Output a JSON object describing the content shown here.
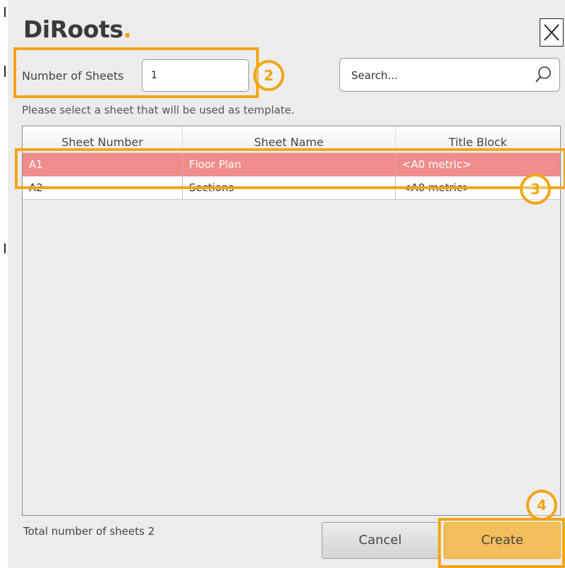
{
  "app": {
    "logo_text": "DiRoots",
    "logo_dot": "."
  },
  "form": {
    "number_label": "Number of Sheets",
    "number_value": "1",
    "search_placeholder": "Search...",
    "hint": "Please select a sheet that will be used as template."
  },
  "table": {
    "columns": [
      "Sheet Number",
      "Sheet Name",
      "Title Block"
    ],
    "rows": [
      {
        "number": "A1",
        "name": "Floor Plan",
        "title_block": "<A0 metric>",
        "selected": true
      },
      {
        "number": "A2",
        "name": "Sections",
        "title_block": "<A0 metric>",
        "selected": false
      }
    ]
  },
  "footer": {
    "total": "Total number of sheets 2",
    "cancel_label": "Cancel",
    "create_label": "Create"
  },
  "annotations": {
    "badges": [
      "2",
      "3",
      "4"
    ],
    "accent_color": "#f2a516"
  },
  "colors": {
    "selected_row": "#f08c8c",
    "create_button": "#f3be5a",
    "dialog_bg": "#ececec"
  },
  "icons": [
    "close-icon",
    "search-icon"
  ]
}
